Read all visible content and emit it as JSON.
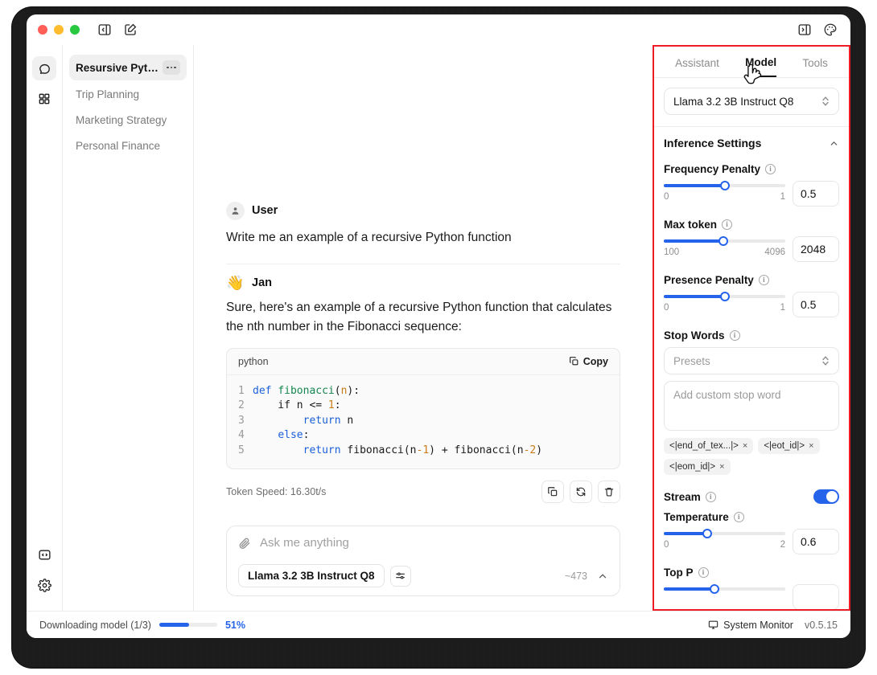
{
  "titlebar": {
    "icons": [
      "sidebar-toggle-icon",
      "new-chat-icon"
    ],
    "right_icons": [
      "right-panel-toggle-icon",
      "theme-palette-icon"
    ]
  },
  "rail": {
    "items": [
      {
        "name": "chat-rail-icon",
        "active": true
      },
      {
        "name": "apps-rail-icon",
        "active": false
      }
    ],
    "bottom": [
      {
        "name": "code-rail-icon"
      },
      {
        "name": "settings-gear-icon"
      }
    ]
  },
  "chatlist": {
    "items": [
      {
        "label": "Resursive Pyth...",
        "active": true
      },
      {
        "label": "Trip Planning",
        "active": false
      },
      {
        "label": "Marketing Strategy",
        "active": false
      },
      {
        "label": "Personal Finance",
        "active": false
      }
    ]
  },
  "thread": {
    "user": {
      "name": "User",
      "text": "Write me an example of a recursive Python function"
    },
    "assistant": {
      "emoji": "👋",
      "name": "Jan",
      "text": "Sure, here's an example of a recursive Python function that calculates the nth number in the Fibonacci sequence:",
      "code": {
        "language": "python",
        "copy_label": "Copy",
        "lines": [
          {
            "n": "1",
            "tokens": [
              [
                "k",
                "def"
              ],
              [
                "d",
                " "
              ],
              [
                "fn",
                "fibonacci"
              ],
              [
                "d",
                "("
              ],
              [
                "p",
                "n"
              ],
              [
                "d",
                "):"
              ]
            ]
          },
          {
            "n": "2",
            "tokens": [
              [
                "d",
                "    if n <= "
              ],
              [
                "p",
                "1"
              ],
              [
                "d",
                ":"
              ]
            ]
          },
          {
            "n": "3",
            "tokens": [
              [
                "d",
                "        "
              ],
              [
                "k",
                "return"
              ],
              [
                "d",
                " n"
              ]
            ]
          },
          {
            "n": "4",
            "tokens": [
              [
                "d",
                "    "
              ],
              [
                "k",
                "else"
              ],
              [
                "d",
                ":"
              ]
            ]
          },
          {
            "n": "5",
            "tokens": [
              [
                "d",
                "        "
              ],
              [
                "k",
                "return"
              ],
              [
                "d",
                " fibonacci(n"
              ],
              [
                "p",
                "-1"
              ],
              [
                "d",
                ") + fibonacci(n"
              ],
              [
                "p",
                "-2"
              ],
              [
                "d",
                ")"
              ]
            ]
          }
        ]
      },
      "token_speed": "Token Speed: 16.30t/s",
      "actions": [
        "copy-icon",
        "regenerate-icon",
        "delete-icon"
      ]
    }
  },
  "composer": {
    "placeholder": "Ask me anything",
    "attach_icon": "paperclip-icon",
    "model_chip": "Llama 3.2 3B Instruct Q8",
    "settings_icon": "sliders-icon",
    "token_count": "~473",
    "expand_icon": "chevron-up-icon"
  },
  "right_panel": {
    "accent_border": "#ee1c25",
    "tabs": [
      {
        "label": "Assistant",
        "active": false
      },
      {
        "label": "Model",
        "active": true
      },
      {
        "label": "Tools",
        "active": false
      }
    ],
    "model_select": "Llama 3.2 3B Instruct Q8",
    "section_title": "Inference Settings",
    "fields": [
      {
        "label": "Frequency Penalty",
        "min": "0",
        "max": "1",
        "value": "0.5",
        "fill_pct": 50
      },
      {
        "label": "Max token",
        "min": "100",
        "max": "4096",
        "value": "2048",
        "fill_pct": 49
      },
      {
        "label": "Presence Penalty",
        "min": "0",
        "max": "1",
        "value": "0.5",
        "fill_pct": 50
      }
    ],
    "stop_words": {
      "label": "Stop Words",
      "preset_placeholder": "Presets",
      "input_placeholder": "Add custom stop word",
      "chips": [
        "<|end_of_tex...|>",
        "<|eot_id|>",
        "<|eom_id|>"
      ]
    },
    "stream": {
      "label": "Stream",
      "enabled": true
    },
    "temperature": {
      "label": "Temperature",
      "min": "0",
      "max": "2",
      "value": "0.6",
      "fill_pct": 36
    },
    "top_p": {
      "label": "Top P"
    },
    "accent_color": "#2563eb"
  },
  "statusbar": {
    "download_text": "Downloading model (1/3)",
    "download_pct_label": "51%",
    "download_pct": 51,
    "system_monitor": "System Monitor",
    "version": "v0.5.15"
  }
}
